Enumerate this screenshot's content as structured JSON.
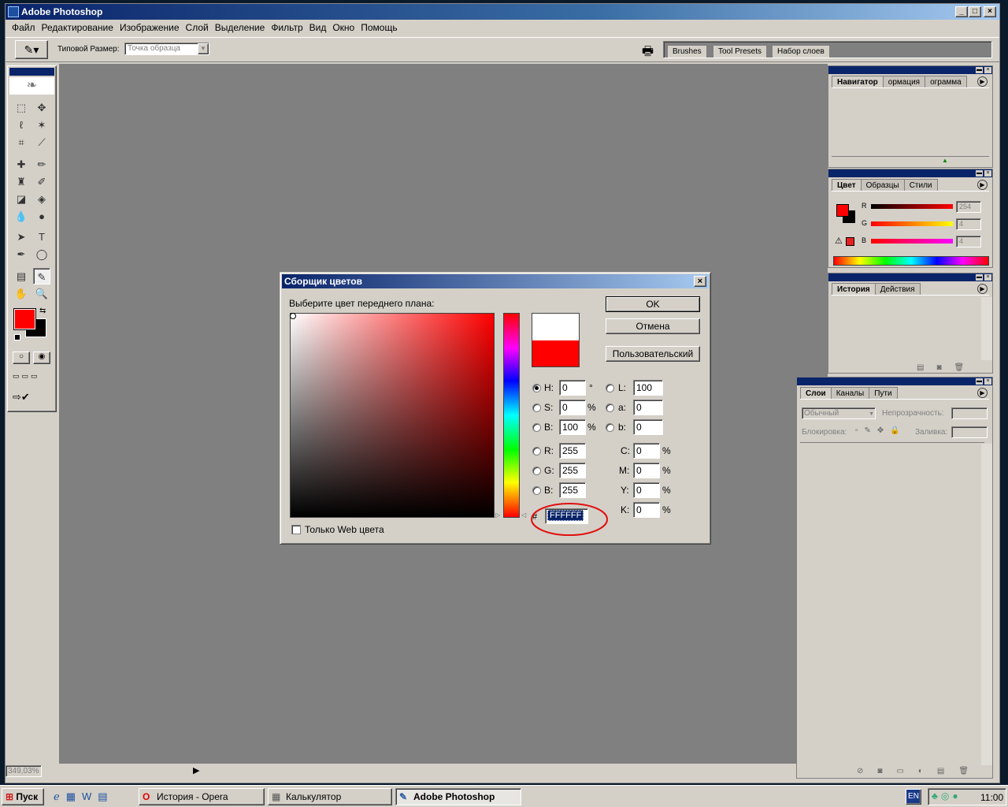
{
  "app": {
    "title": "Adobe Photoshop",
    "menu": [
      "Файл",
      "Редактирование",
      "Изображение",
      "Слой",
      "Выделение",
      "Фильтр",
      "Вид",
      "Окно",
      "Помощь"
    ],
    "options": {
      "sample_size_label": "Типовой Размер:",
      "sample_size_value": "Точка образца",
      "palette_well_tabs": [
        "Brushes",
        "Tool Presets",
        "Набор слоев"
      ]
    },
    "status_zoom": "349,03%"
  },
  "navigator_panel": {
    "tabs": [
      "Навигатор",
      "ормация",
      "ограмма"
    ]
  },
  "color_panel": {
    "tabs": [
      "Цвет",
      "Образцы",
      "Стили"
    ],
    "channels": [
      {
        "name": "R",
        "value": "254"
      },
      {
        "name": "G",
        "value": "4"
      },
      {
        "name": "B",
        "value": "4"
      }
    ]
  },
  "history_panel": {
    "tabs": [
      "История",
      "Действия"
    ]
  },
  "layers_panel": {
    "tabs": [
      "Слои",
      "Каналы",
      "Пути"
    ],
    "blend_mode": "Обычный",
    "opacity_label": "Непрозрачность:",
    "lock_label": "Блокировка:",
    "fill_label": "Заливка:"
  },
  "color_picker": {
    "title": "Сборщик цветов",
    "prompt": "Выберите цвет переднего плана:",
    "ok": "OK",
    "cancel": "Отмена",
    "custom": "Пользовательский",
    "web_only": "Только Web цвета",
    "fields": {
      "H": "0",
      "S": "0",
      "Bv": "100",
      "L": "100",
      "a": "0",
      "b": "0",
      "R": "255",
      "G": "255",
      "B": "255",
      "C": "0",
      "M": "0",
      "Y": "0",
      "K": "0"
    },
    "units": {
      "deg": "°",
      "pct": "%"
    },
    "hex_label": "#",
    "hex": "FFFFFF"
  },
  "taskbar": {
    "start": "Пуск",
    "tasks": [
      "История - Opera",
      "Калькулятор",
      "Adobe Photoshop"
    ],
    "lang": "EN",
    "clock": "11:00"
  },
  "colors": {
    "foreground": "#ff0000",
    "background": "#000000",
    "accent": "#0a246a"
  }
}
